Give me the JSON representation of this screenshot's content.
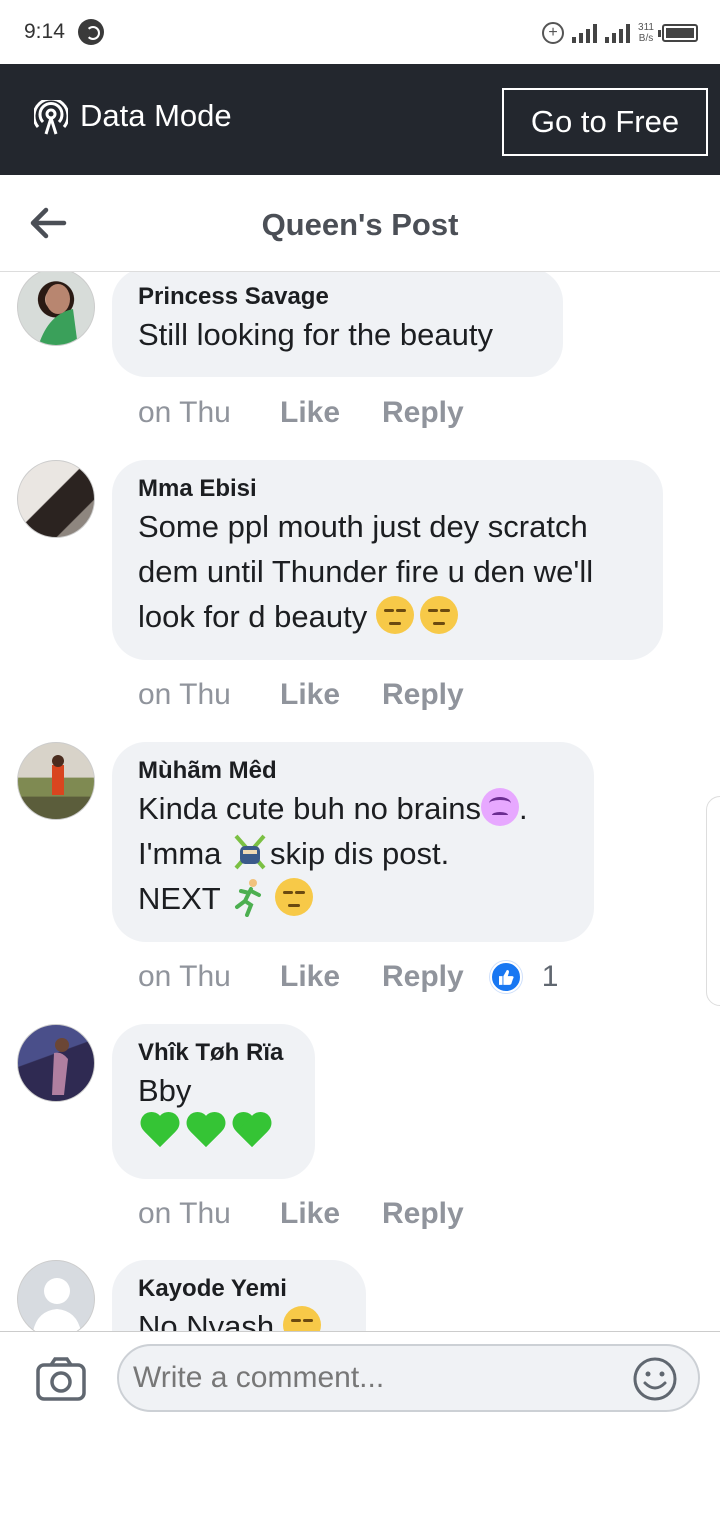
{
  "status_bar": {
    "time": "9:14",
    "signal_type": "H+",
    "speed_value": "311",
    "speed_unit": "B/s"
  },
  "data_mode": {
    "label": "Data Mode",
    "go_free_label": "Go to Free"
  },
  "header": {
    "title": "Queen's Post"
  },
  "comments": [
    {
      "author": "Princess Savage",
      "lines": [
        "Still looking for the beauty"
      ],
      "time": "on Thu",
      "like_label": "Like",
      "reply_label": "Reply"
    },
    {
      "author": "Mma Ebisi",
      "lines": [
        "Some ppl mouth just dey scratch",
        "dem until Thunder fire u den we'll",
        "look for d beauty"
      ],
      "emojis": [
        "unamused-face",
        "unamused-face"
      ],
      "time": "on Thu",
      "like_label": "Like",
      "reply_label": "Reply"
    },
    {
      "author": "Mùhãm Mêd",
      "lines": [
        "Kinda cute buh no brains",
        ".",
        "I'mma ",
        "skip dis post.",
        "NEXT "
      ],
      "emojis": [
        "dizzy-face",
        "ninja",
        "running-man",
        "unamused-face"
      ],
      "time": "on Thu",
      "like_label": "Like",
      "reply_label": "Reply",
      "reaction_count": "1"
    },
    {
      "author": "Vhîk Tøh Rïa",
      "lines": [
        "Bby"
      ],
      "emojis": [
        "green-heart",
        "green-heart",
        "green-heart"
      ],
      "time": "on Thu",
      "like_label": "Like",
      "reply_label": "Reply"
    },
    {
      "author": "Kayode Yemi",
      "lines": [
        "No Nyash"
      ],
      "emojis": [
        "unamused-face"
      ]
    }
  ],
  "composer": {
    "placeholder": "Write a comment..."
  },
  "colors": {
    "data_bar": "#23272e",
    "bubble": "#f0f2f5",
    "like_blue": "#1877f2",
    "muted_text": "#90949c"
  }
}
